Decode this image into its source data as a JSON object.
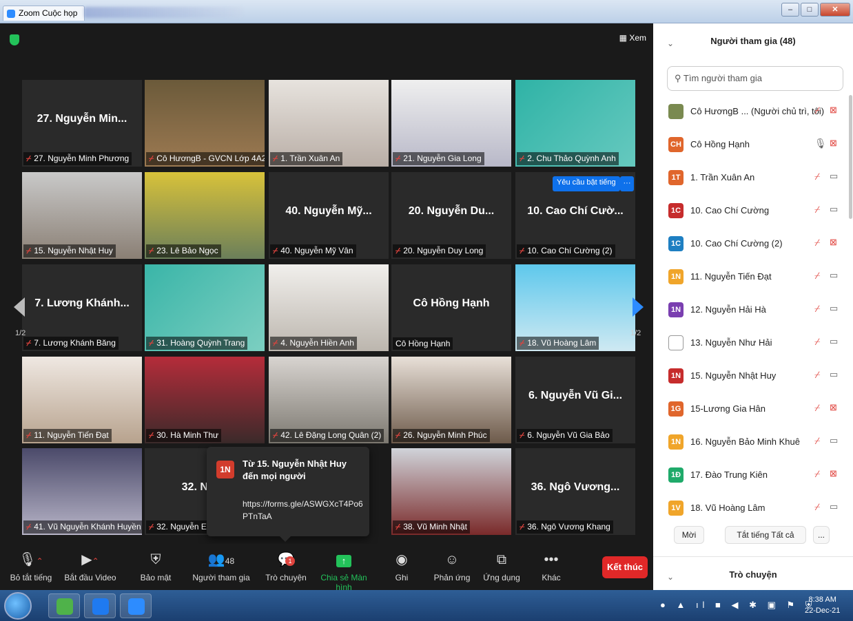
{
  "window": {
    "tab_title": "Zoom Cuộc họp"
  },
  "meeting": {
    "view_label": "Xem",
    "page_left": "1/2",
    "page_right": "1/2",
    "unmute_request": "Yêu cầu bật tiếng",
    "unmute_more": "···",
    "tiles": [
      {
        "big": "27. Nguyễn Min...",
        "label": "27. Nguyễn Minh Phương"
      },
      {
        "big": "",
        "label": "Cô HươngB - GVCN Lớp 4A2"
      },
      {
        "big": "",
        "label": "1. Trần Xuân An"
      },
      {
        "big": "",
        "label": "21. Nguyễn Gia Long"
      },
      {
        "big": "",
        "label": "2. Chu Thảo Quỳnh Anh"
      },
      {
        "big": "",
        "label": "15. Nguyễn Nhật Huy"
      },
      {
        "big": "",
        "label": "23. Lê Bảo Ngọc"
      },
      {
        "big": "40. Nguyễn Mỹ...",
        "label": "40. Nguyễn Mỹ Vân"
      },
      {
        "big": "20. Nguyễn Du...",
        "label": "20. Nguyễn Duy Long"
      },
      {
        "big": "10. Cao Chí Cườ...",
        "label": "10. Cao Chí Cường (2)"
      },
      {
        "big": "7. Lương Khánh...",
        "label": "7. Lương Khánh Băng"
      },
      {
        "big": "",
        "label": "31. Hoàng Quỳnh Trang"
      },
      {
        "big": "",
        "label": "4. Nguyễn Hiền Anh"
      },
      {
        "big": "Cô Hồng Hạnh",
        "label": "Cô Hồng Hạnh"
      },
      {
        "big": "",
        "label": "18. Vũ Hoàng Lâm"
      },
      {
        "big": "",
        "label": "11. Nguyễn Tiến Đạt"
      },
      {
        "big": "",
        "label": "30. Hà Minh Thư"
      },
      {
        "big": "",
        "label": "42. Lê Đặng Long Quân (2)"
      },
      {
        "big": "",
        "label": "26. Nguyễn Minh Phúc"
      },
      {
        "big": "6. Nguyễn Vũ Gi...",
        "label": "6. Nguyễn Vũ Gia Bảo"
      },
      {
        "big": "",
        "label": "41. Vũ Nguyễn Khánh Huyền"
      },
      {
        "big": "32. Nguy",
        "label": "32. Nguyễn E"
      },
      {
        "big": "",
        "label": ""
      },
      {
        "big": "",
        "label": "38. Vũ Minh Nhật"
      },
      {
        "big": "36. Ngô Vương...",
        "label": "36. Ngô Vương Khang"
      }
    ],
    "chat_popup": {
      "avatar": "1N",
      "from": "Từ 15. Nguyễn Nhật Huy đến mọi người",
      "message": "https://forms.gle/ASWGXcT4Po6PTnTaA"
    }
  },
  "toolbar": {
    "mute": "Bỏ tắt tiếng",
    "video": "Bắt đầu Video",
    "security": "Bảo mật",
    "participants": "Người tham gia",
    "participants_count": "48",
    "chat": "Trò chuyện",
    "chat_badge": "1",
    "share": "Chia sẻ Màn hình",
    "record": "Ghi",
    "reactions": "Phản ứng",
    "apps": "Ứng dụng",
    "more": "Khác",
    "end": "Kết thúc"
  },
  "panel": {
    "title": "Người tham gia (48)",
    "search_placeholder": "Tìm người tham gia",
    "participants": [
      {
        "avatar": "",
        "name": "Cô HươngB ... (Người chủ trì, tôi)",
        "color": "#7a8a50",
        "mic_on": false,
        "cam_on": false
      },
      {
        "avatar": "CH",
        "name": "Cô Hồng Hạnh",
        "color": "#e0662c",
        "mic_on": true,
        "cam_on": false
      },
      {
        "avatar": "1T",
        "name": "1. Trần Xuân An",
        "color": "#e0662c",
        "mic_on": false,
        "cam_on": true
      },
      {
        "avatar": "1C",
        "name": "10. Cao Chí Cường",
        "color": "#c62c2c",
        "mic_on": false,
        "cam_on": true
      },
      {
        "avatar": "1C",
        "name": "10. Cao Chí Cường (2)",
        "color": "#1e7fc2",
        "mic_on": false,
        "cam_on": false
      },
      {
        "avatar": "1N",
        "name": "11. Nguyễn Tiến Đạt",
        "color": "#f0a52a",
        "mic_on": false,
        "cam_on": true
      },
      {
        "avatar": "1N",
        "name": "12. Nguyễn Hải Hà",
        "color": "#7a3fb0",
        "mic_on": false,
        "cam_on": true
      },
      {
        "avatar": "",
        "name": "13. Nguyễn Như Hải",
        "color": "#ffffff",
        "mic_on": false,
        "cam_on": true
      },
      {
        "avatar": "1N",
        "name": "15. Nguyễn Nhật Huy",
        "color": "#c62c2c",
        "mic_on": false,
        "cam_on": true
      },
      {
        "avatar": "1G",
        "name": "15-Lương Gia Hân",
        "color": "#e0662c",
        "mic_on": false,
        "cam_on": false
      },
      {
        "avatar": "1N",
        "name": "16. Nguyễn Bảo Minh Khuê",
        "color": "#f0a52a",
        "mic_on": false,
        "cam_on": true
      },
      {
        "avatar": "1Đ",
        "name": "17. Đào Trung Kiên",
        "color": "#1faa6a",
        "mic_on": false,
        "cam_on": false
      },
      {
        "avatar": "1V",
        "name": "18. Vũ Hoàng Lâm",
        "color": "#f0a52a",
        "mic_on": false,
        "cam_on": true
      }
    ],
    "invite": "Mời",
    "mute_all": "Tắt tiếng Tất cả",
    "more": "...",
    "chat_title": "Trò chuyện"
  },
  "taskbar": {
    "time": "8:38 AM",
    "date": "22-Dec-21"
  }
}
